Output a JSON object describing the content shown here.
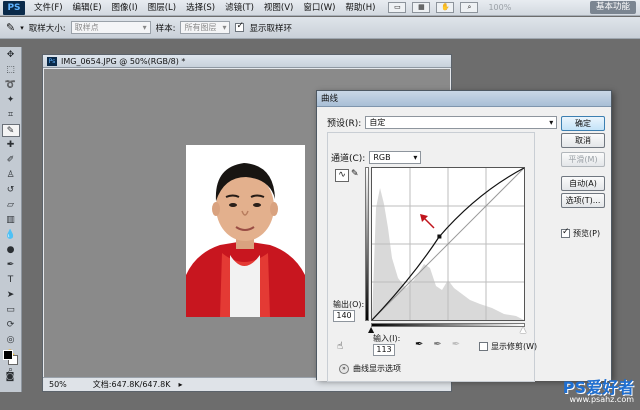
{
  "app": {
    "logo": "PS",
    "menu": [
      "文件(F)",
      "编辑(E)",
      "图像(I)",
      "图层(L)",
      "选择(S)",
      "滤镜(T)",
      "视图(V)",
      "窗口(W)",
      "帮助(H)"
    ],
    "zoom": "100%",
    "workspace": "基本功能"
  },
  "options": {
    "sample_size_label": "取样大小:",
    "sample_size_value": "取样点",
    "sample_label": "样本:",
    "sample_value": "所有图层",
    "show_ring_label": "显示取样环",
    "show_ring_checked": true
  },
  "document": {
    "title": "IMG_0654.JPG @ 50%(RGB/8) *",
    "zoom": "50%",
    "doc_size": "文档:647.8K/647.8K"
  },
  "curves": {
    "title": "曲线",
    "preset_label": "预设(R):",
    "preset_value": "自定",
    "channel_label": "通道(C):",
    "channel_value": "RGB",
    "output_label": "输出(O):",
    "output_value": "140",
    "input_label": "输入(I):",
    "input_value": "113",
    "clipping_label": "显示修剪(W)",
    "curve_options_label": "曲线显示选项",
    "buttons": {
      "ok": "确定",
      "cancel": "取消",
      "smooth": "平滑(M)",
      "auto": "自动(A)",
      "options": "选项(T)...",
      "preview": "预览(P)"
    },
    "preview_checked": true,
    "point": {
      "input": 113,
      "output": 140
    }
  },
  "watermark": {
    "brand": "PS爱好者",
    "url": "www.psahz.com"
  }
}
